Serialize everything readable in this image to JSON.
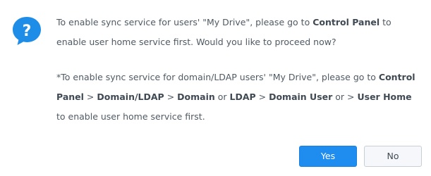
{
  "dialog": {
    "icon": "question-bubble-icon",
    "accent_color": "#1f8cf0",
    "message1": {
      "t1": "To enable sync service for users' \"My Drive\", please go to ",
      "b1": "Control Panel",
      "t2": " to enable user home service first. Would you like to proceed now?"
    },
    "message2": {
      "t1": "*To enable sync service for domain/LDAP users' \"My Drive\", please go to ",
      "b1": "Control Panel",
      "t2": " > ",
      "b2": "Domain/LDAP",
      "t3": " > ",
      "b3": "Domain",
      "t4": " or ",
      "b4": "LDAP",
      "t5": " > ",
      "b5": "Domain User",
      "t6": " or > ",
      "b6": "User Home",
      "t7": " to enable user home service first."
    },
    "buttons": {
      "yes_label": "Yes",
      "no_label": "No"
    }
  }
}
